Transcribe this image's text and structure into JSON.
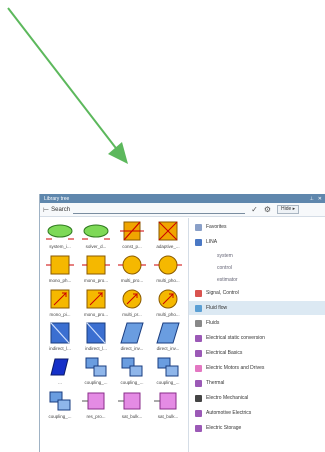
{
  "colors": {
    "arrow": "#5cb85c",
    "titlebar": "#5f87ad",
    "selection": "#dce9f3"
  },
  "panel": {
    "title": "Library tree",
    "pin_glyph": "⊥",
    "close_glyph": "✕"
  },
  "search": {
    "label": "Search",
    "value": "",
    "more_label": "Hide ▸",
    "check_glyph": "✓",
    "gear_glyph": "⚙"
  },
  "components": [
    {
      "label": "system_i...",
      "shape": "ellipse-green"
    },
    {
      "label": "solver_d...",
      "shape": "ellipse-green"
    },
    {
      "label": "const_p...",
      "shape": "square-slash"
    },
    {
      "label": "adaptive_...",
      "shape": "square-x"
    },
    {
      "label": "mono_ph...",
      "shape": "square-yellow"
    },
    {
      "label": "mono_pro...",
      "shape": "square-yellow"
    },
    {
      "label": "multi_pro...",
      "shape": "circle-yellow"
    },
    {
      "label": "multi_pho...",
      "shape": "circle-yellow"
    },
    {
      "label": "mono_pi...",
      "shape": "square-arrow"
    },
    {
      "label": "mono_pro...",
      "shape": "square-arrow"
    },
    {
      "label": "multi_pr...",
      "shape": "circle-arrow"
    },
    {
      "label": "multi_pho...",
      "shape": "circle-arrow"
    },
    {
      "label": "indirect_l...",
      "shape": "blue-diag"
    },
    {
      "label": "indirect_l...",
      "shape": "blue-diag"
    },
    {
      "label": "direct_inv...",
      "shape": "blue-para"
    },
    {
      "label": "direct_inv...",
      "shape": "blue-para"
    },
    {
      "label": "...",
      "shape": "blue-dark"
    },
    {
      "label": "coupling_...",
      "shape": "blue-stack"
    },
    {
      "label": "coupling_...",
      "shape": "blue-stack"
    },
    {
      "label": "coupling_...",
      "shape": "blue-stack"
    },
    {
      "label": "coupling_...",
      "shape": "blue-stack"
    },
    {
      "label": "res_pro...",
      "shape": "pink"
    },
    {
      "label": "sat_bulk...",
      "shape": "pink"
    },
    {
      "label": "sat_bulk...",
      "shape": "pink"
    }
  ],
  "tree": [
    {
      "label": "Favorites",
      "icon": "#8aa0c8",
      "type": "top"
    },
    {
      "label": "LINA",
      "icon": "#4a78c4",
      "type": "top"
    },
    {
      "label": "system",
      "type": "sub"
    },
    {
      "label": "control",
      "type": "sub"
    },
    {
      "label": "estimator",
      "type": "sub"
    },
    {
      "label": "Signal, Control",
      "icon": "#d9534f",
      "type": "top"
    },
    {
      "label": "Fluid flow",
      "icon": "#5a9fd4",
      "type": "top",
      "selected": true
    },
    {
      "label": "Fluids",
      "icon": "#888888",
      "type": "top"
    },
    {
      "label": "Electrical static conversion",
      "icon": "#9b59b6",
      "type": "top"
    },
    {
      "label": "Electrical Basics",
      "icon": "#9b59b6",
      "type": "top"
    },
    {
      "label": "Electric Motors and Drives",
      "icon": "#e377c2",
      "type": "top"
    },
    {
      "label": "Thermal",
      "icon": "#9b59b6",
      "type": "top"
    },
    {
      "label": "Electro Mechanical",
      "icon": "#444444",
      "type": "top"
    },
    {
      "label": "Automotive Electrics",
      "icon": "#9b59b6",
      "type": "top"
    },
    {
      "label": "Electric Storage",
      "icon": "#9b59b6",
      "type": "top"
    }
  ]
}
